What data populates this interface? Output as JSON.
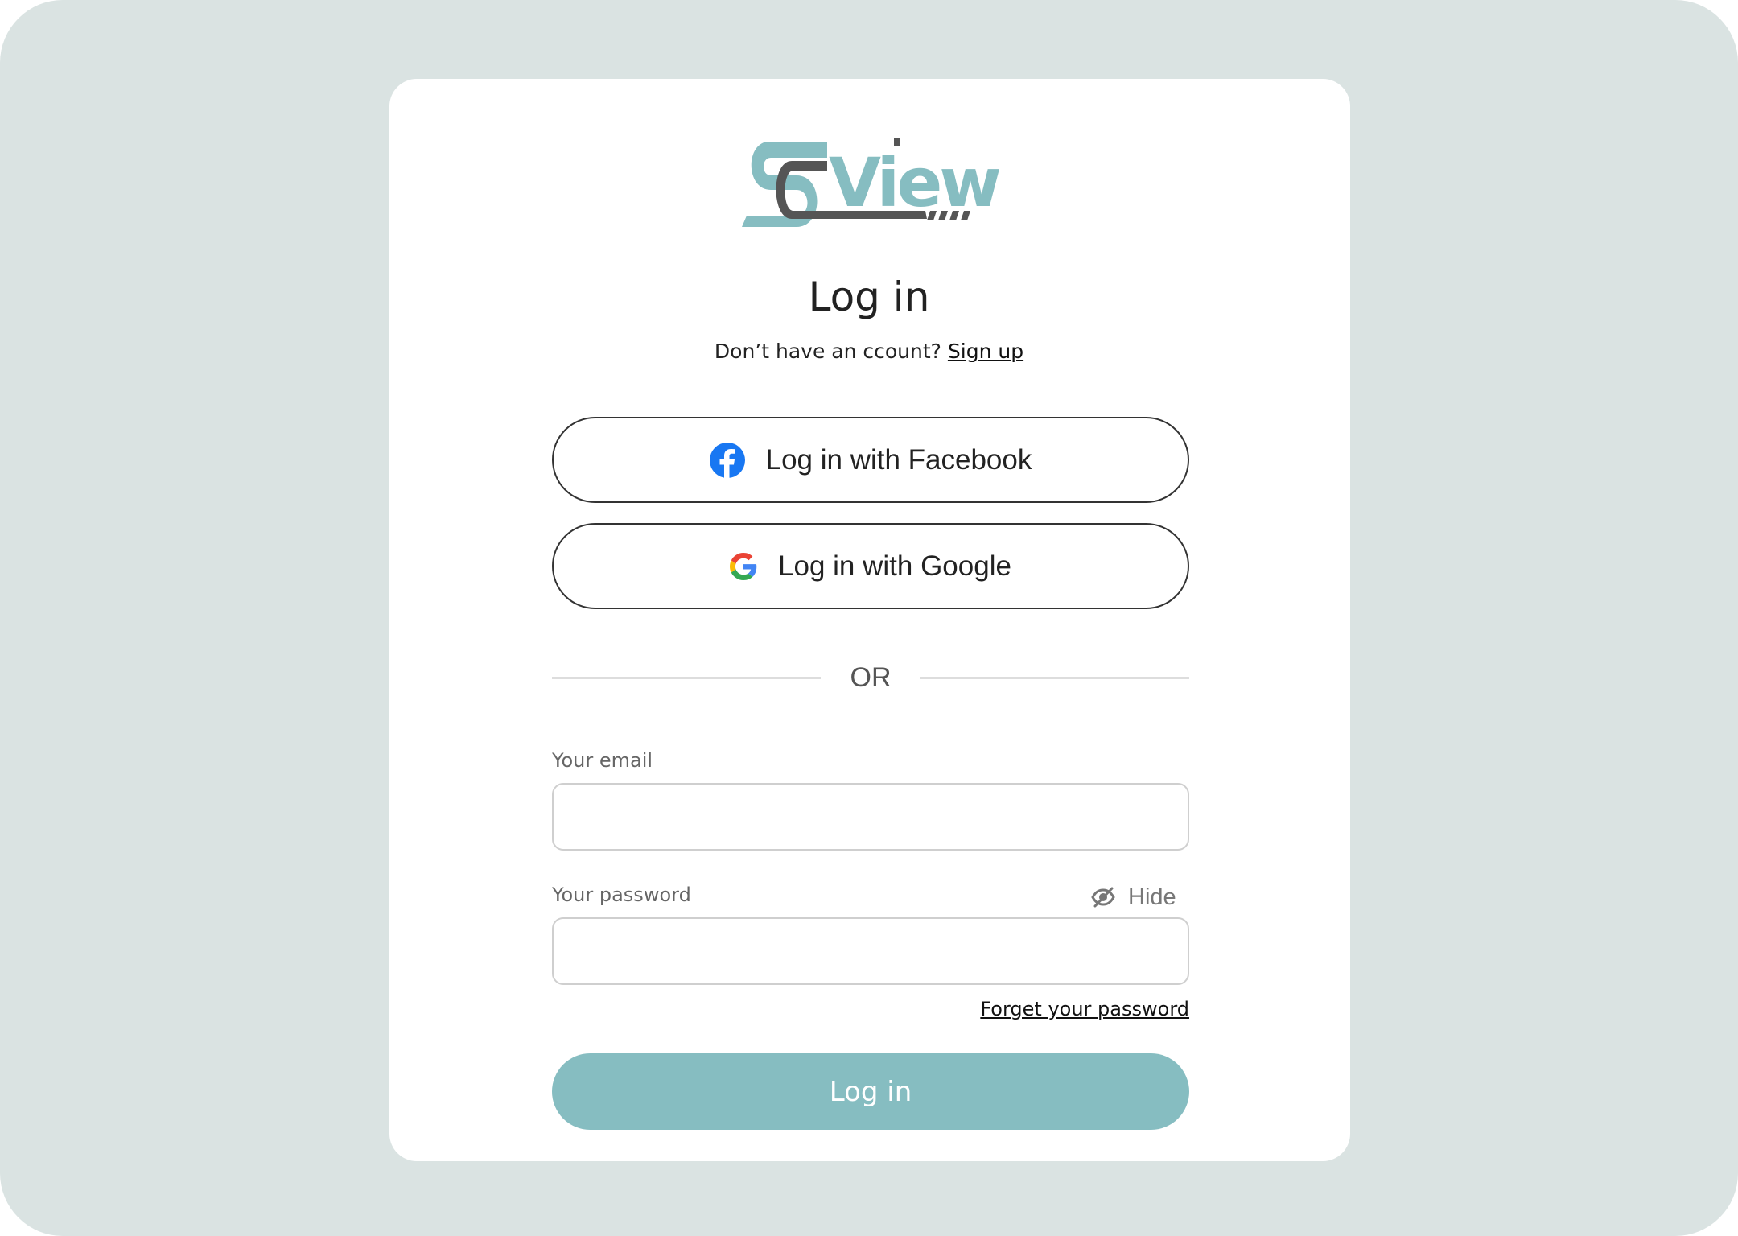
{
  "brand": {
    "logo_text": "SCView",
    "accent_color": "#86bdc1",
    "dark_color": "#555555"
  },
  "login": {
    "title": "Log in",
    "subtitle_text": "Don’t have an ccount? ",
    "signup_link": "Sign up"
  },
  "oauth": {
    "facebook_label": "Log in with Facebook",
    "google_label": "Log in with Google"
  },
  "divider": {
    "text": "OR"
  },
  "form": {
    "email_label": "Your email",
    "email_value": "",
    "password_label": "Your password",
    "password_value": "",
    "hide_label": "Hide",
    "forgot_link": "Forget your password",
    "submit_label": "Log in"
  },
  "icons": {
    "facebook": "facebook-icon",
    "google": "google-icon",
    "hide": "eye-slash-icon"
  }
}
